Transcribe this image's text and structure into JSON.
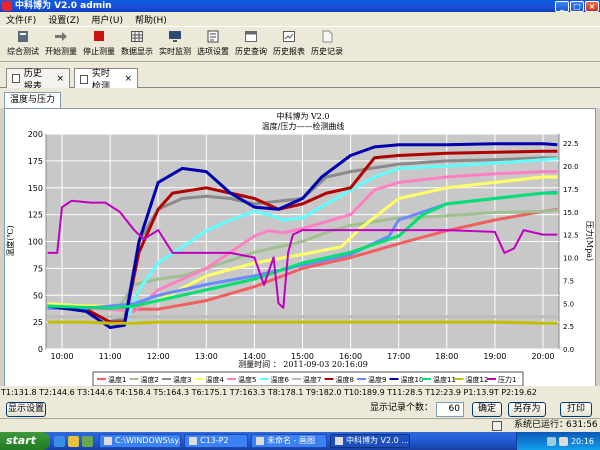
{
  "window": {
    "title": "中科博为 V2.0 admin"
  },
  "menu": [
    "文件(F)",
    "设置(Z)",
    "用户(U)",
    "帮助(H)"
  ],
  "toolbar": [
    {
      "label": "综合测试",
      "icon": "wrench-icon",
      "color": "#5a6a7a"
    },
    {
      "label": "开始测量",
      "icon": "arrow-right-icon",
      "color": "#777777"
    },
    {
      "label": "停止测量",
      "icon": "stop-icon",
      "color": "#cc1111"
    },
    {
      "label": "数据显示",
      "icon": "grid-icon",
      "color": "#555555"
    },
    {
      "label": "实时监测",
      "icon": "monitor-icon",
      "color": "#2e4a74"
    },
    {
      "label": "选项设置",
      "icon": "checklist-icon",
      "color": "#444444"
    },
    {
      "label": "历史查询",
      "icon": "window-icon",
      "color": "#6a6a6a"
    },
    {
      "label": "历史报表",
      "icon": "report-icon",
      "color": "#5a5a5a"
    },
    {
      "label": "历史记录",
      "icon": "document-icon",
      "color": "#8a8a8a"
    }
  ],
  "tabs": [
    {
      "label": "历史报表",
      "active": false
    },
    {
      "label": "实时检测",
      "active": true
    }
  ],
  "subtab": "温度与压力",
  "chart_data": {
    "type": "line",
    "title": "中科博为 V2.0",
    "subtitle": "温度/压力——检测曲线",
    "xlabel": "测量时间 ： 2011-09-03 20:16:09",
    "ylabel_left": "温度(℃)",
    "ylabel_right": "压力(Mpa)",
    "x_ticks": [
      "10:00",
      "11:00",
      "12:00",
      "13:00",
      "14:00",
      "15:00",
      "16:00",
      "17:00",
      "18:00",
      "19:00",
      "20:00"
    ],
    "x_range": [
      9.667,
      20.333
    ],
    "y_left_ticks": [
      0,
      25,
      50,
      75,
      100,
      125,
      150,
      175,
      200
    ],
    "y_left_range": [
      0,
      200
    ],
    "y_right_ticks": [
      0.0,
      2.5,
      5.0,
      7.5,
      10.0,
      12.5,
      15.0,
      17.5,
      20.0,
      22.5
    ],
    "y_right_range": [
      0,
      23.5
    ],
    "grid": true,
    "background": "#c8c8c8",
    "legend_position": "bottom",
    "series": [
      {
        "name": "温度1",
        "color": "#f06060",
        "axis": "left",
        "x": [
          9.7,
          10.5,
          11.0,
          11.2,
          11.5,
          12.0,
          13.0,
          14.0,
          15.0,
          16.0,
          17.0,
          18.0,
          19.0,
          20.0,
          20.3
        ],
        "y": [
          41,
          40,
          38,
          37,
          37,
          37,
          45,
          58,
          75,
          85,
          98,
          110,
          120,
          128,
          130
        ]
      },
      {
        "name": "温度2",
        "color": "#a0c090",
        "axis": "left",
        "x": [
          9.7,
          11.0,
          11.2,
          11.5,
          12.0,
          12.5,
          13.0,
          14.0,
          15.0,
          15.6,
          16.0,
          17.0,
          17.3,
          18.0,
          19.0,
          20.0,
          20.3
        ],
        "y": [
          41,
          39,
          40,
          60,
          65,
          68,
          75,
          90,
          100,
          110,
          115,
          122,
          122,
          124,
          127,
          128,
          129
        ]
      },
      {
        "name": "温度3",
        "color": "#8a8a8a",
        "axis": "left",
        "x": [
          9.7,
          10.5,
          10.9,
          11.3,
          11.6,
          12.0,
          12.5,
          13.0,
          13.5,
          14.0,
          15.0,
          15.5,
          16.0,
          17.0,
          18.0,
          19.0,
          20.0,
          20.3
        ],
        "y": [
          38,
          37,
          25,
          28,
          100,
          130,
          140,
          142,
          140,
          135,
          140,
          160,
          165,
          172,
          175,
          176,
          178,
          178
        ]
      },
      {
        "name": "温度4",
        "color": "#ffff66",
        "axis": "left",
        "x": [
          9.7,
          10.5,
          11.0,
          11.5,
          12.0,
          13.0,
          14.0,
          15.0,
          15.8,
          16.2,
          17.0,
          18.0,
          19.0,
          20.0,
          20.3
        ],
        "y": [
          42,
          40,
          40,
          40,
          45,
          68,
          80,
          88,
          95,
          112,
          140,
          150,
          155,
          160,
          160
        ]
      },
      {
        "name": "温度5",
        "color": "#ff80c0",
        "axis": "left",
        "x": [
          9.7,
          10.5,
          11.0,
          11.5,
          12.0,
          13.0,
          13.5,
          14.0,
          14.3,
          14.6,
          15.0,
          16.0,
          16.5,
          17.0,
          18.0,
          19.0,
          20.0,
          20.3
        ],
        "y": [
          40,
          38,
          37,
          35,
          55,
          75,
          90,
          105,
          110,
          108,
          112,
          125,
          148,
          155,
          160,
          163,
          165,
          165
        ]
      },
      {
        "name": "温度6",
        "color": "#60ffff",
        "axis": "left",
        "x": [
          9.7,
          10.5,
          11.0,
          11.3,
          11.6,
          12.0,
          12.5,
          13.0,
          13.5,
          14.0,
          14.3,
          14.6,
          15.0,
          16.0,
          16.5,
          17.0,
          18.0,
          19.0,
          20.0,
          20.3
        ],
        "y": [
          40,
          37,
          20,
          22,
          55,
          80,
          95,
          110,
          120,
          128,
          125,
          120,
          122,
          148,
          160,
          168,
          170,
          173,
          176,
          177
        ]
      },
      {
        "name": "温度7",
        "color": "#bbbbbb",
        "axis": "left",
        "x": [
          9.7,
          20.3
        ],
        "y": [
          30,
          30
        ]
      },
      {
        "name": "温度8",
        "color": "#b00000",
        "axis": "left",
        "x": [
          9.7,
          10.5,
          11.0,
          11.3,
          11.6,
          12.0,
          12.3,
          13.0,
          13.5,
          14.0,
          14.5,
          15.0,
          15.5,
          16.0,
          16.5,
          17.0,
          18.0,
          19.0,
          20.0,
          20.3
        ],
        "y": [
          40,
          37,
          25,
          25,
          90,
          130,
          145,
          150,
          145,
          140,
          130,
          135,
          145,
          150,
          178,
          180,
          182,
          183,
          184,
          184
        ]
      },
      {
        "name": "温度9",
        "color": "#6a8aff",
        "axis": "left",
        "x": [
          9.7,
          10.5,
          11.0,
          11.5,
          12.0,
          13.0,
          14.0,
          15.0,
          16.0,
          16.8,
          17.0,
          18.0,
          19.0,
          20.0,
          20.3
        ],
        "y": [
          38,
          38,
          40,
          42,
          50,
          60,
          68,
          78,
          88,
          105,
          120,
          135,
          140,
          145,
          146
        ]
      },
      {
        "name": "温度10",
        "color": "#0000b0",
        "axis": "left",
        "x": [
          9.7,
          10.5,
          11.0,
          11.3,
          11.6,
          12.0,
          12.5,
          13.0,
          13.5,
          14.0,
          14.5,
          15.0,
          15.4,
          16.0,
          16.5,
          17.0,
          18.0,
          19.0,
          20.0,
          20.3
        ],
        "y": [
          40,
          35,
          20,
          22,
          100,
          155,
          168,
          165,
          145,
          132,
          130,
          140,
          160,
          180,
          188,
          190,
          190,
          191,
          191,
          190
        ]
      },
      {
        "name": "温度11",
        "color": "#00e070",
        "axis": "left",
        "x": [
          9.7,
          11.0,
          11.5,
          12.0,
          13.0,
          14.0,
          15.0,
          16.0,
          17.0,
          17.5,
          18.0,
          19.0,
          20.0,
          20.3
        ],
        "y": [
          40,
          38,
          40,
          45,
          55,
          65,
          80,
          90,
          105,
          125,
          135,
          140,
          145,
          145
        ]
      },
      {
        "name": "温度12",
        "color": "#c0c000",
        "axis": "left",
        "x": [
          9.7,
          10.5,
          11.0,
          11.5,
          12.0,
          13.0,
          14.0,
          15.0,
          16.0,
          17.0,
          18.0,
          19.0,
          20.0,
          20.3
        ],
        "y": [
          25,
          25,
          24,
          24,
          25,
          25,
          25,
          25,
          25,
          25,
          25,
          25,
          24,
          24
        ]
      },
      {
        "name": "压力1",
        "color": "#c000c0",
        "axis": "right",
        "x": [
          9.7,
          9.9,
          10.0,
          10.2,
          10.6,
          10.9,
          11.2,
          11.5,
          11.7,
          12.0,
          12.3,
          13.0,
          13.5,
          14.0,
          14.2,
          14.4,
          14.5,
          14.6,
          14.7,
          14.8,
          15.0,
          16.0,
          17.0,
          18.0,
          19.0,
          19.2,
          19.4,
          19.6,
          20.0,
          20.3
        ],
        "y": [
          10.5,
          10.5,
          15.5,
          16.2,
          16.0,
          16.0,
          15.0,
          13.0,
          12.0,
          13.0,
          10.5,
          10.5,
          10.5,
          10.0,
          7.0,
          10.0,
          5.0,
          4.5,
          10.5,
          12.5,
          13.0,
          13.0,
          13.0,
          13.0,
          12.8,
          10.5,
          11.0,
          13.0,
          12.5,
          12.5
        ]
      }
    ]
  },
  "readout": "T1:131.8 T2:144.6 T3:144.6 T4:158.4 T5:164.3 T6:175.1 T7:163.3 T8:178.1 T9:182.0 T10:189.9 T11:28.5 T12:23.9 P1:13.9T P2:19.62",
  "controls": {
    "display_settings": "显示设置",
    "record_count_label": "显示记录个数：",
    "record_count_value": "60",
    "confirm": "确定",
    "save_as": "另存为",
    "print": "打印"
  },
  "status": {
    "running_label": "系统已运行：",
    "running_time": "631:56"
  },
  "taskbar": {
    "start": "start",
    "tasks": [
      {
        "label": "C:\\WINDOWS\\sy...",
        "active": false
      },
      {
        "label": "C13-P2",
        "active": false
      },
      {
        "label": "未命名 - 画图",
        "active": false
      },
      {
        "label": "中科博为 V2.0 ...",
        "active": true
      }
    ],
    "clock": "20:16"
  }
}
